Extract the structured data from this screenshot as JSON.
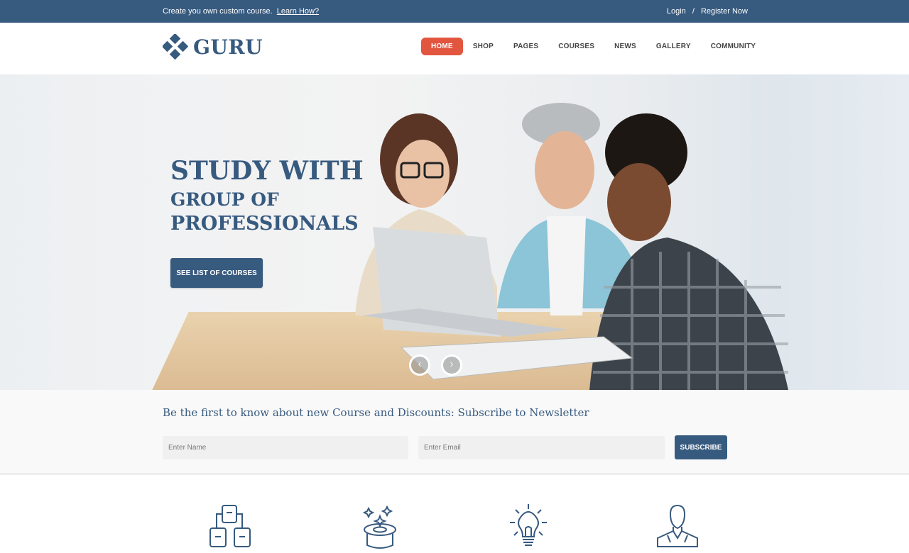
{
  "topbar": {
    "promo_text": "Create you own custom course.",
    "promo_link": "Learn How?",
    "login": "Login",
    "separator": "/",
    "register": "Register Now"
  },
  "header": {
    "logo_text": "GURU",
    "nav": [
      {
        "label": "HOME",
        "active": true
      },
      {
        "label": "SHOP"
      },
      {
        "label": "PAGES"
      },
      {
        "label": "COURSES"
      },
      {
        "label": "NEWS"
      },
      {
        "label": "GALLERY"
      },
      {
        "label": "COMMUNITY"
      }
    ]
  },
  "hero": {
    "line1": "STUDY WITH",
    "line2": "GROUP OF",
    "line3": "PROFESSIONALS",
    "cta_label": "SEE LIST OF COURSES",
    "prev_icon": "chevron-left-icon",
    "next_icon": "chevron-right-icon",
    "prev_glyph": "‹",
    "next_glyph": "›"
  },
  "newsletter": {
    "heading": "Be the first to know about new Course and Discounts: Subscribe to Newsletter",
    "name_placeholder": "Enter Name",
    "email_placeholder": "Enter Email",
    "subscribe_label": "SUBSCRIBE"
  },
  "features": {
    "icons": [
      "hierarchy-icon",
      "magic-hat-icon",
      "lightbulb-icon",
      "person-icon"
    ]
  },
  "colors": {
    "brand": "#375a7f",
    "accent": "#e2553f"
  }
}
